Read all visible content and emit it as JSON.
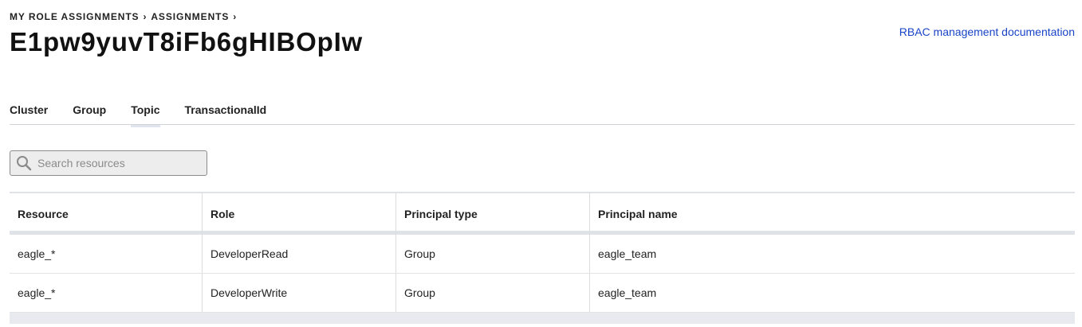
{
  "breadcrumb": {
    "items": [
      "MY ROLE ASSIGNMENTS",
      "ASSIGNMENTS"
    ],
    "separator": "›"
  },
  "page": {
    "title": "E1pw9yuvT8iFb6gHIBOpIw",
    "doc_link": "RBAC management documentation"
  },
  "tabs": [
    {
      "label": "Cluster",
      "active": false
    },
    {
      "label": "Group",
      "active": false
    },
    {
      "label": "Topic",
      "active": true
    },
    {
      "label": "TransactionalId",
      "active": false
    }
  ],
  "search": {
    "placeholder": "Search resources",
    "value": "",
    "icon": "search-icon"
  },
  "table": {
    "columns": [
      "Resource",
      "Role",
      "Principal type",
      "Principal name"
    ],
    "rows": [
      [
        "eagle_*",
        "DeveloperRead",
        "Group",
        "eagle_team"
      ],
      [
        "eagle_*",
        "DeveloperWrite",
        "Group",
        "eagle_team"
      ]
    ]
  },
  "colors": {
    "link": "#1a44c7",
    "active_tab_underline": "#dfe4ef",
    "search_bg": "#ededed"
  }
}
